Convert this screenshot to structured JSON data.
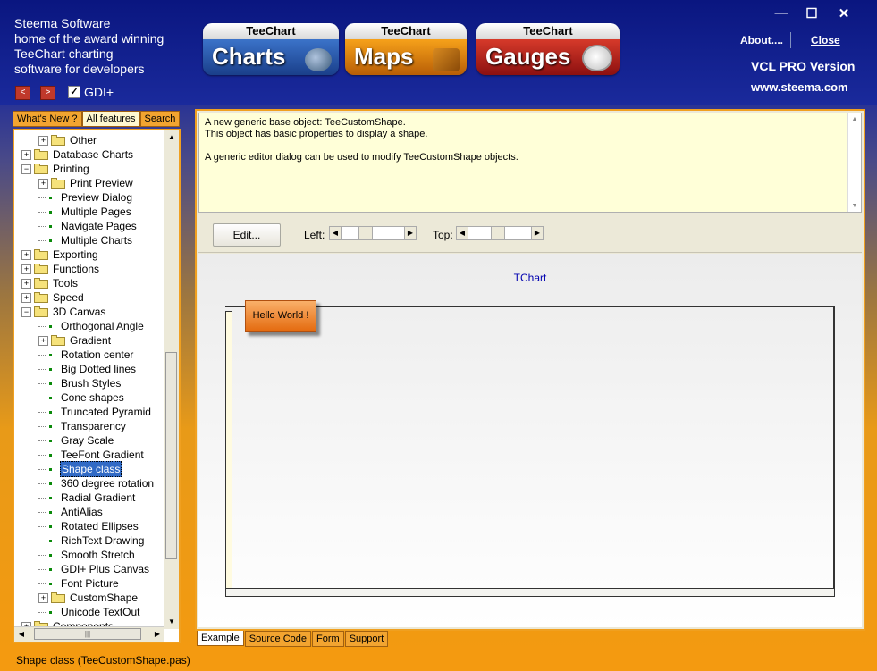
{
  "header": {
    "tagline": [
      "Steema Software",
      "home of the award winning",
      "TeeChart charting",
      "software for developers"
    ],
    "nav_prev": "<",
    "nav_next": ">",
    "gdi_label": "GDI+",
    "gdi_checked": true,
    "logos": [
      {
        "top": "TeeChart",
        "bottom": "Charts"
      },
      {
        "top": "TeeChart",
        "bottom": "Maps"
      },
      {
        "top": "TeeChart",
        "bottom": "Gauges"
      }
    ],
    "about_label": "About....",
    "close_label": "Close",
    "version_label": "VCL PRO Version",
    "website": "www.steema.com",
    "win_min": "—",
    "win_max": "☐",
    "win_close": "✕"
  },
  "left_tabs": [
    {
      "label": "What's New ?",
      "active": false
    },
    {
      "label": "All features",
      "active": true
    },
    {
      "label": "Search",
      "active": false
    }
  ],
  "tree": [
    {
      "label": "Other",
      "level": 1,
      "type": "folder",
      "expand": "+"
    },
    {
      "label": "Database Charts",
      "level": 0,
      "type": "folder",
      "expand": "+"
    },
    {
      "label": "Printing",
      "level": 0,
      "type": "folder",
      "expand": "-"
    },
    {
      "label": "Print Preview",
      "level": 1,
      "type": "folder",
      "expand": "+"
    },
    {
      "label": "Preview Dialog",
      "level": 1,
      "type": "leaf"
    },
    {
      "label": "Multiple Pages",
      "level": 1,
      "type": "leaf"
    },
    {
      "label": "Navigate Pages",
      "level": 1,
      "type": "leaf"
    },
    {
      "label": "Multiple Charts",
      "level": 1,
      "type": "leaf"
    },
    {
      "label": "Exporting",
      "level": 0,
      "type": "folder",
      "expand": "+"
    },
    {
      "label": "Functions",
      "level": 0,
      "type": "folder",
      "expand": "+"
    },
    {
      "label": "Tools",
      "level": 0,
      "type": "folder",
      "expand": "+"
    },
    {
      "label": "Speed",
      "level": 0,
      "type": "folder",
      "expand": "+"
    },
    {
      "label": "3D Canvas",
      "level": 0,
      "type": "folder",
      "expand": "-"
    },
    {
      "label": "Orthogonal Angle",
      "level": 1,
      "type": "leaf"
    },
    {
      "label": "Gradient",
      "level": 1,
      "type": "folder",
      "expand": "+"
    },
    {
      "label": "Rotation center",
      "level": 1,
      "type": "leaf"
    },
    {
      "label": "Big Dotted lines",
      "level": 1,
      "type": "leaf"
    },
    {
      "label": "Brush Styles",
      "level": 1,
      "type": "leaf"
    },
    {
      "label": "Cone shapes",
      "level": 1,
      "type": "leaf"
    },
    {
      "label": "Truncated Pyramid",
      "level": 1,
      "type": "leaf"
    },
    {
      "label": "Transparency",
      "level": 1,
      "type": "leaf"
    },
    {
      "label": "Gray Scale",
      "level": 1,
      "type": "leaf"
    },
    {
      "label": "TeeFont Gradient",
      "level": 1,
      "type": "leaf"
    },
    {
      "label": "Shape class",
      "level": 1,
      "type": "leaf",
      "selected": true
    },
    {
      "label": "360 degree rotation",
      "level": 1,
      "type": "leaf"
    },
    {
      "label": "Radial Gradient",
      "level": 1,
      "type": "leaf"
    },
    {
      "label": "AntiAlias",
      "level": 1,
      "type": "leaf"
    },
    {
      "label": "Rotated Ellipses",
      "level": 1,
      "type": "leaf"
    },
    {
      "label": "RichText Drawing",
      "level": 1,
      "type": "leaf"
    },
    {
      "label": "Smooth Stretch",
      "level": 1,
      "type": "leaf"
    },
    {
      "label": "GDI+ Plus Canvas",
      "level": 1,
      "type": "leaf"
    },
    {
      "label": "Font Picture",
      "level": 1,
      "type": "leaf"
    },
    {
      "label": "CustomShape",
      "level": 1,
      "type": "folder",
      "expand": "+"
    },
    {
      "label": "Unicode TextOut",
      "level": 1,
      "type": "leaf"
    },
    {
      "label": "Components",
      "level": 0,
      "type": "folder",
      "expand": "+"
    }
  ],
  "description": {
    "line1": "A new generic base object: TeeCustomShape.",
    "line2": "This object has basic properties to display a shape.",
    "line3": "A generic editor dialog can be used to modify TeeCustomShape objects."
  },
  "toolbar": {
    "edit_label": "Edit...",
    "left_label": "Left:",
    "top_label": "Top:"
  },
  "chart": {
    "title": "TChart",
    "shape_text": "Hello World !"
  },
  "bottom_tabs": [
    {
      "label": "Example",
      "active": true
    },
    {
      "label": "Source Code",
      "active": false
    },
    {
      "label": "Form",
      "active": false
    },
    {
      "label": "Support",
      "active": false
    }
  ],
  "status": "Shape class (TeeCustomShape.pas)",
  "colors": {
    "header_blue": "#0d1a8c",
    "accent_orange": "#f49a10",
    "selection": "#316ac5",
    "chart_title": "#0000b0"
  }
}
